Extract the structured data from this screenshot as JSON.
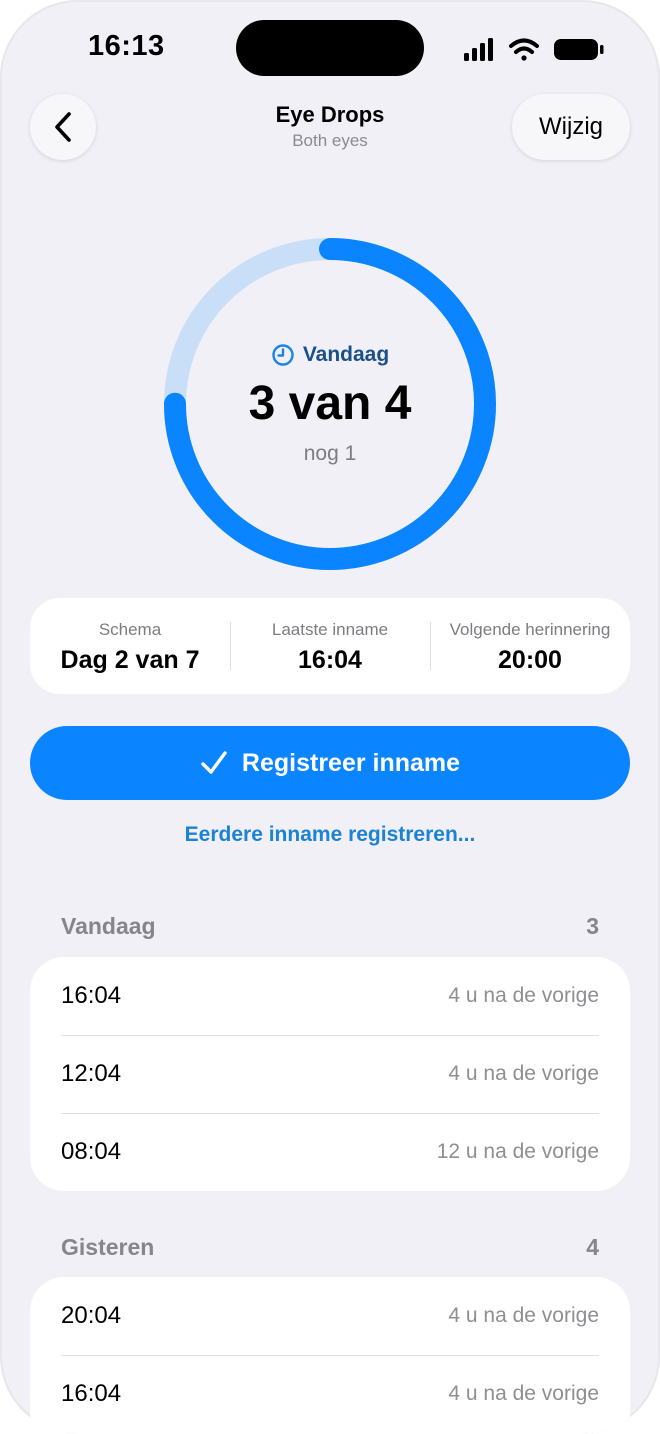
{
  "status_bar": {
    "time": "16:13",
    "icons": [
      "cellular-signal-icon",
      "wifi-icon",
      "battery-icon"
    ]
  },
  "header": {
    "back_icon": "chevron-left-icon",
    "title": "Eye Drops",
    "subtitle": "Both eyes",
    "edit_label": "Wijzig"
  },
  "progress": {
    "label": "Vandaag",
    "label_icon": "clock-icon",
    "value_text": "3 van 4",
    "remaining_text": "nog 1",
    "taken": 3,
    "total": 4,
    "fill_color": "#0a84ff",
    "track_color": "#c9dff7"
  },
  "info": [
    {
      "label": "Schema",
      "value": "Dag 2 van 7"
    },
    {
      "label": "Laatste inname",
      "value": "16:04"
    },
    {
      "label": "Volgende herinnering",
      "value": "20:00"
    }
  ],
  "actions": {
    "register_label": "Registreer inname",
    "register_icon": "checkmark-icon",
    "earlier_label": "Eerdere inname registreren..."
  },
  "sections": [
    {
      "title": "Vandaag",
      "count": "3",
      "rows": [
        {
          "time": "16:04",
          "note": "4 u na de vorige"
        },
        {
          "time": "12:04",
          "note": "4 u na de vorige"
        },
        {
          "time": "08:04",
          "note": "12 u na de vorige"
        }
      ]
    },
    {
      "title": "Gisteren",
      "count": "4",
      "rows": [
        {
          "time": "20:04",
          "note": "4 u na de vorige"
        },
        {
          "time": "16:04",
          "note": "4 u na de vorige"
        }
      ]
    }
  ],
  "colors": {
    "accent": "#0a84ff",
    "link": "#1b82d6",
    "background": "#f1f0f6"
  }
}
